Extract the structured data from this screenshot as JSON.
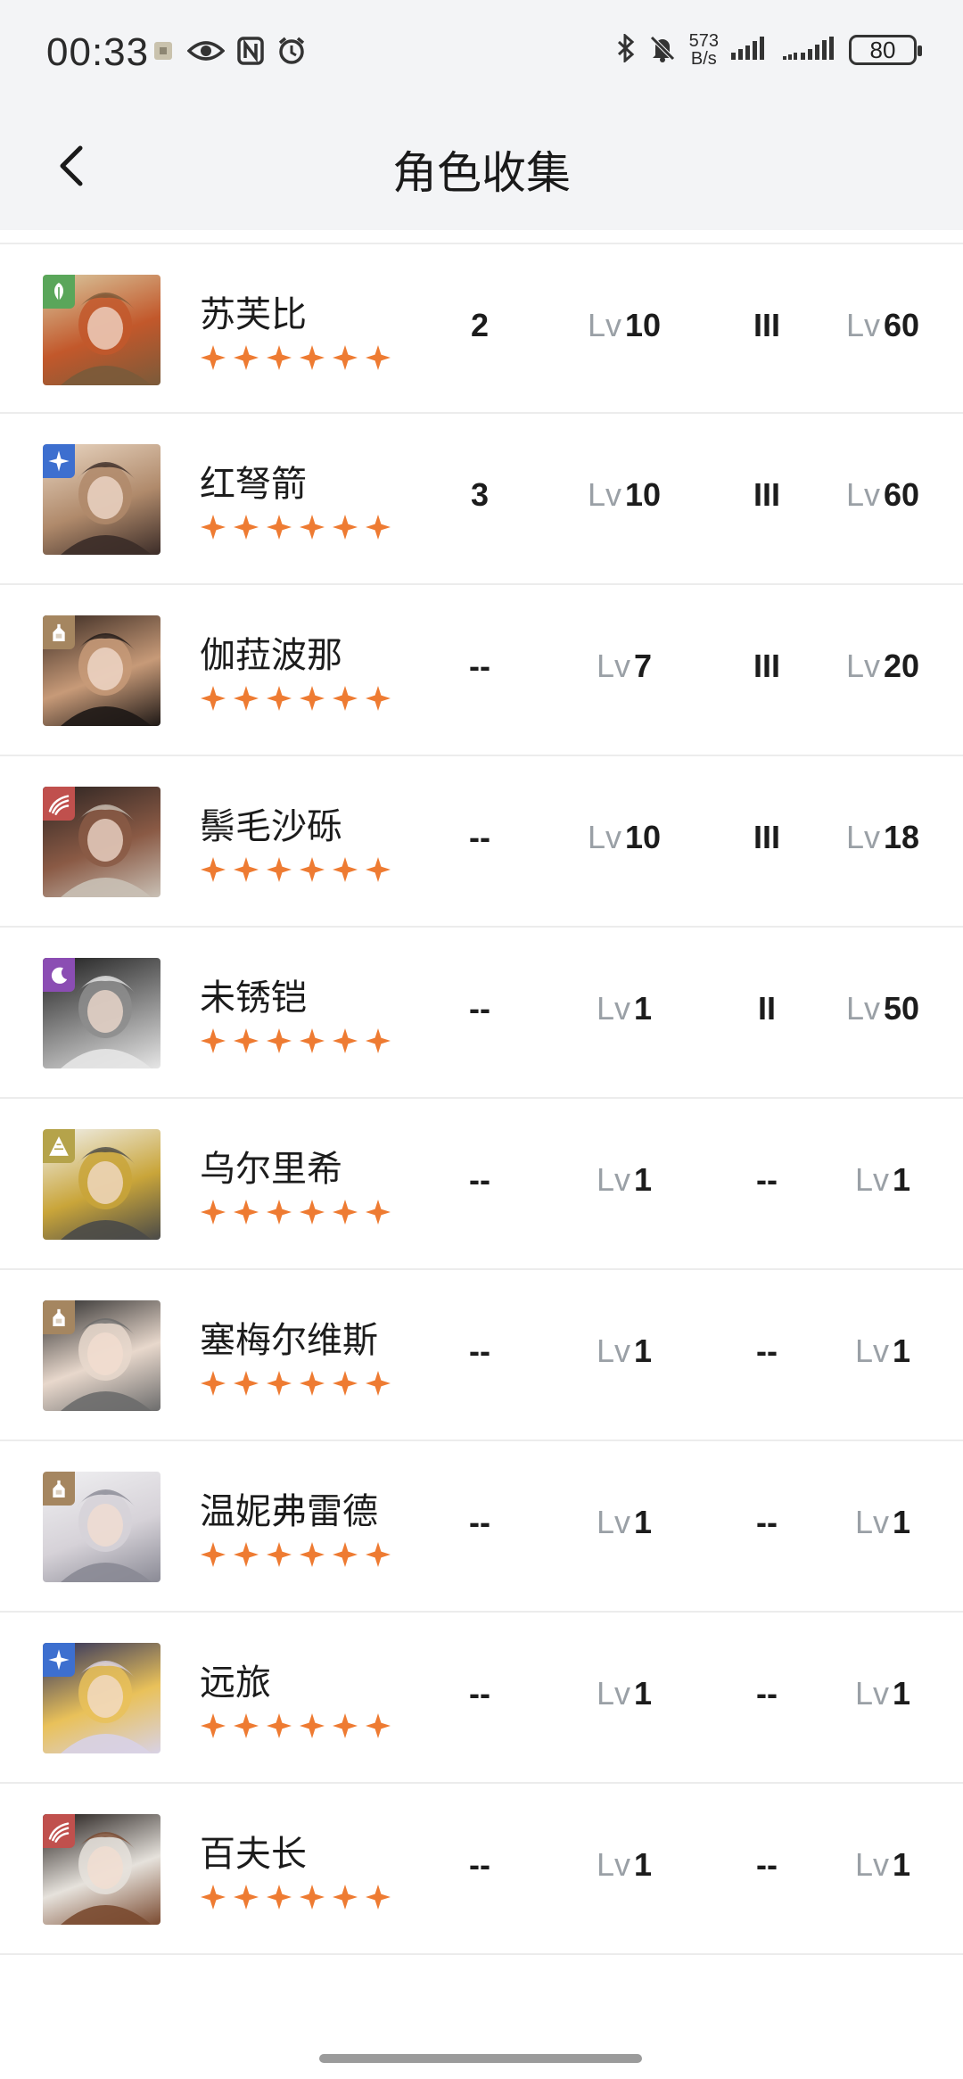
{
  "status_bar": {
    "time": "00:33",
    "net_speed_value": "573",
    "net_speed_unit": "B/s",
    "battery": "80"
  },
  "header": {
    "title": "角色收集"
  },
  "colors": {
    "star": "#ee7b32",
    "lv_prefix": "#9aa0a6"
  },
  "lv_prefix": "Lv",
  "characters": [
    {
      "name": "苏芙比",
      "col1": "2",
      "col2": "10",
      "col3": "III",
      "col4": "60",
      "badge_icon": "leaf-icon",
      "badge_color": "#5aa65a"
    },
    {
      "name": "红弩箭",
      "col1": "3",
      "col2": "10",
      "col3": "III",
      "col4": "60",
      "badge_icon": "star-sparkle-icon",
      "badge_color": "#3d6fcf"
    },
    {
      "name": "伽菈波那",
      "col1": "--",
      "col2": "7",
      "col3": "III",
      "col4": "20",
      "badge_icon": "bottle-icon",
      "badge_color": "#a58660"
    },
    {
      "name": "鬃毛沙砾",
      "col1": "--",
      "col2": "10",
      "col3": "III",
      "col4": "18",
      "badge_icon": "claw-icon",
      "badge_color": "#c0504d"
    },
    {
      "name": "未锈铠",
      "col1": "--",
      "col2": "1",
      "col3": "II",
      "col4": "50",
      "badge_icon": "moon-icon",
      "badge_color": "#8b4db3"
    },
    {
      "name": "乌尔里希",
      "col1": "--",
      "col2": "1",
      "col3": "--",
      "col4": "1",
      "badge_icon": "pyramid-icon",
      "badge_color": "#b5a34a"
    },
    {
      "name": "塞梅尔维斯",
      "col1": "--",
      "col2": "1",
      "col3": "--",
      "col4": "1",
      "badge_icon": "bottle-icon",
      "badge_color": "#a58660"
    },
    {
      "name": "温妮弗雷德",
      "col1": "--",
      "col2": "1",
      "col3": "--",
      "col4": "1",
      "badge_icon": "bottle-icon",
      "badge_color": "#a58660"
    },
    {
      "name": "远旅",
      "col1": "--",
      "col2": "1",
      "col3": "--",
      "col4": "1",
      "badge_icon": "star-sparkle-icon",
      "badge_color": "#3d6fcf"
    },
    {
      "name": "百夫长",
      "col1": "--",
      "col2": "1",
      "col3": "--",
      "col4": "1",
      "badge_icon": "claw-icon",
      "badge_color": "#c0504d"
    }
  ]
}
